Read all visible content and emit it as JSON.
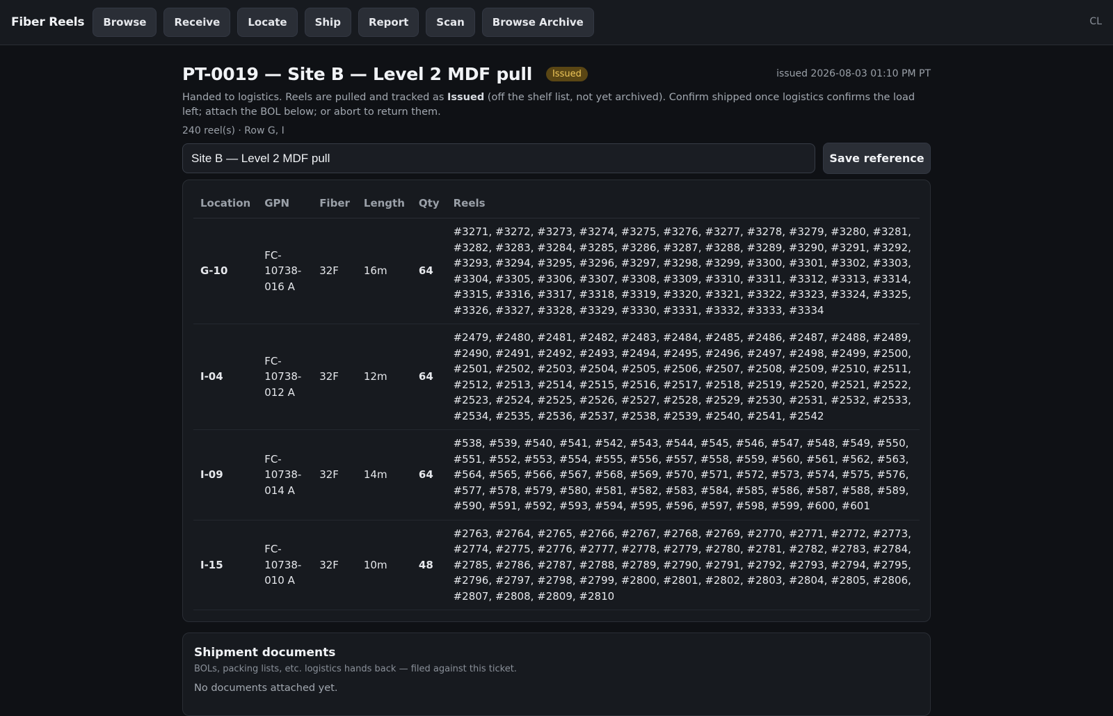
{
  "app": {
    "brand": "Fiber Reels",
    "user_initials": "CL"
  },
  "nav": {
    "items": [
      {
        "label": "Browse"
      },
      {
        "label": "Receive"
      },
      {
        "label": "Locate"
      },
      {
        "label": "Ship"
      },
      {
        "label": "Report"
      },
      {
        "label": "Scan"
      },
      {
        "label": "Browse Archive"
      }
    ]
  },
  "ticket": {
    "title": "PT-0019 — Site B — Level 2 MDF pull",
    "status": "Issued",
    "issued": "issued 2026-08-03 01:10 PM PT",
    "description_pre": "Handed to logistics. Reels are pulled and tracked as ",
    "description_bold": "Issued",
    "description_post": " (off the shelf list, not yet archived). Confirm shipped once logistics confirms the load left; attach the BOL below; or abort to return them.",
    "summary": "240 reel(s) · Row G, I",
    "reference_value": "Site B — Level 2 MDF pull",
    "save_label": "Save reference"
  },
  "table": {
    "headers": {
      "location": "Location",
      "gpn": "GPN",
      "fiber": "Fiber",
      "length": "Length",
      "qty": "Qty",
      "reels": "Reels"
    },
    "rows": [
      {
        "location": "G-10",
        "gpn": "FC-10738-016 A",
        "fiber": "32F",
        "length": "16m",
        "qty": "64",
        "reels": "#3271, #3272, #3273, #3274, #3275, #3276, #3277, #3278, #3279, #3280, #3281, #3282, #3283, #3284, #3285, #3286, #3287, #3288, #3289, #3290, #3291, #3292, #3293, #3294, #3295, #3296, #3297, #3298, #3299, #3300, #3301, #3302, #3303, #3304, #3305, #3306, #3307, #3308, #3309, #3310, #3311, #3312, #3313, #3314, #3315, #3316, #3317, #3318, #3319, #3320, #3321, #3322, #3323, #3324, #3325, #3326, #3327, #3328, #3329, #3330, #3331, #3332, #3333, #3334"
      },
      {
        "location": "I-04",
        "gpn": "FC-10738-012 A",
        "fiber": "32F",
        "length": "12m",
        "qty": "64",
        "reels": "#2479, #2480, #2481, #2482, #2483, #2484, #2485, #2486, #2487, #2488, #2489, #2490, #2491, #2492, #2493, #2494, #2495, #2496, #2497, #2498, #2499, #2500, #2501, #2502, #2503, #2504, #2505, #2506, #2507, #2508, #2509, #2510, #2511, #2512, #2513, #2514, #2515, #2516, #2517, #2518, #2519, #2520, #2521, #2522, #2523, #2524, #2525, #2526, #2527, #2528, #2529, #2530, #2531, #2532, #2533, #2534, #2535, #2536, #2537, #2538, #2539, #2540, #2541, #2542"
      },
      {
        "location": "I-09",
        "gpn": "FC-10738-014 A",
        "fiber": "32F",
        "length": "14m",
        "qty": "64",
        "reels": "#538, #539, #540, #541, #542, #543, #544, #545, #546, #547, #548, #549, #550, #551, #552, #553, #554, #555, #556, #557, #558, #559, #560, #561, #562, #563, #564, #565, #566, #567, #568, #569, #570, #571, #572, #573, #574, #575, #576, #577, #578, #579, #580, #581, #582, #583, #584, #585, #586, #587, #588, #589, #590, #591, #592, #593, #594, #595, #596, #597, #598, #599, #600, #601"
      },
      {
        "location": "I-15",
        "gpn": "FC-10738-010 A",
        "fiber": "32F",
        "length": "10m",
        "qty": "48",
        "reels": "#2763, #2764, #2765, #2766, #2767, #2768, #2769, #2770, #2771, #2772, #2773, #2774, #2775, #2776, #2777, #2778, #2779, #2780, #2781, #2782, #2783, #2784, #2785, #2786, #2787, #2788, #2789, #2790, #2791, #2792, #2793, #2794, #2795, #2796, #2797, #2798, #2799, #2800, #2801, #2802, #2803, #2804, #2805, #2806, #2807, #2808, #2809, #2810"
      }
    ]
  },
  "documents": {
    "title": "Shipment documents",
    "subtitle": "BOLs, packing lists, etc. logistics hands back — filed against this ticket.",
    "empty": "No documents attached yet."
  },
  "colors": {
    "background": "#0f1115",
    "surface": "#171a1f",
    "button": "#2a2e36",
    "status_badge_bg": "#5a4614",
    "status_badge_text": "#f0c85a"
  }
}
